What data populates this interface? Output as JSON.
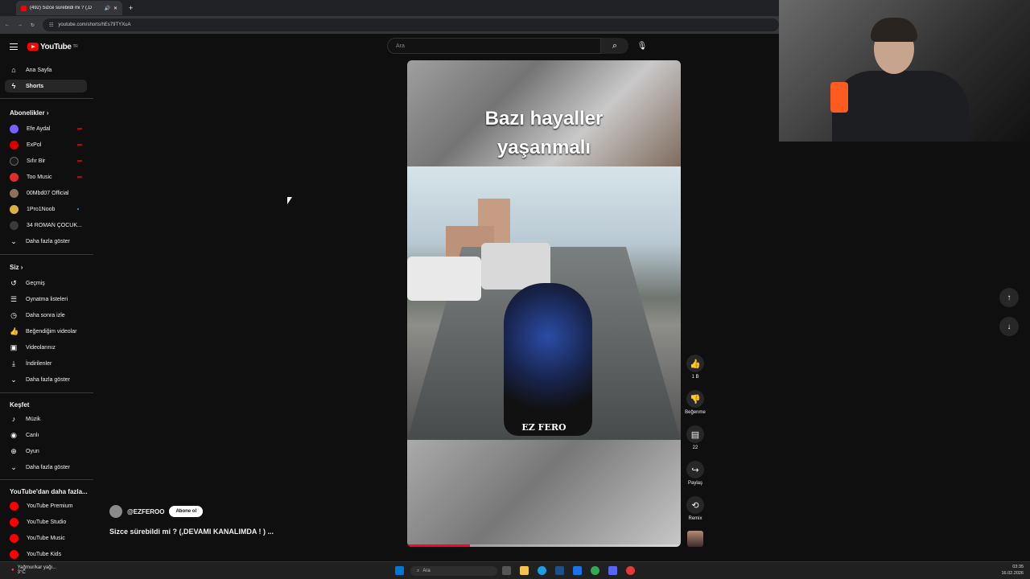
{
  "browser": {
    "tab_title": "(492) Sizce sürebildi mi ? (,D",
    "url": "youtube.com/shorts/hEs79TYXuA"
  },
  "header": {
    "logo": "YouTube",
    "country": "TR",
    "search_placeholder": "Ara"
  },
  "sidebar": {
    "main": [
      {
        "label": "Ana Sayfa",
        "icon": "home-icon"
      },
      {
        "label": "Shorts",
        "icon": "shorts-icon"
      }
    ],
    "subs_title": "Abonelikler",
    "subscriptions": [
      {
        "label": "Efe Aydal",
        "color": "#7a5cff",
        "live": true
      },
      {
        "label": "ExPol",
        "color": "#d60000",
        "live": true
      },
      {
        "label": "Sıfır Bir",
        "color": "#1a1a1a",
        "live": true
      },
      {
        "label": "Too Music",
        "color": "#e12c2c",
        "live": true
      },
      {
        "label": "00Mbd07 Official",
        "color": "#8b7359",
        "live": false
      },
      {
        "label": "1Pro1Noob",
        "color": "#d8b23f",
        "live": false,
        "new": true
      },
      {
        "label": "34 ROMAN ÇOCUK...",
        "color": "#3a3a3a",
        "live": false
      }
    ],
    "subs_more": "Daha fazla göster",
    "you_title": "Siz",
    "you": [
      {
        "label": "Geçmiş",
        "icon": "history-icon"
      },
      {
        "label": "Oynatma listeleri",
        "icon": "playlist-icon"
      },
      {
        "label": "Daha sonra izle",
        "icon": "watch-later-icon"
      },
      {
        "label": "Beğendiğim videolar",
        "icon": "like-icon"
      },
      {
        "label": "Videolarınız",
        "icon": "your-videos-icon"
      },
      {
        "label": "İndirilenler",
        "icon": "download-icon"
      },
      {
        "label": "Daha fazla göster",
        "icon": "chevron-down-icon"
      }
    ],
    "explore_title": "Keşfet",
    "explore": [
      {
        "label": "Müzik",
        "icon": "music-icon"
      },
      {
        "label": "Canlı",
        "icon": "live-icon"
      },
      {
        "label": "Oyun",
        "icon": "gaming-icon"
      },
      {
        "label": "Daha fazla göster",
        "icon": "chevron-down-icon"
      }
    ],
    "more_title": "YouTube'dan daha fazla...",
    "more": [
      {
        "label": "YouTube Premium"
      },
      {
        "label": "YouTube Studio"
      },
      {
        "label": "YouTube Music"
      },
      {
        "label": "YouTube Kids"
      }
    ]
  },
  "short": {
    "caption_line1": "Bazı hayaller",
    "caption_line2": "yaşanmalı",
    "watermark": "EZ FERO",
    "progress": 0.23,
    "channel": "@EZFEROO",
    "subscribe": "Abone ol",
    "title": "Sizce sürebildi mi ? (,DEVAMI KANALIMDA ! ) ..."
  },
  "actions": {
    "like_count": "1 B",
    "dislike": "Beğenme",
    "comment_count": "22",
    "share": "Paylaş",
    "remix": "Remix"
  },
  "taskbar": {
    "weather": "Yağmur/kar yağı...",
    "temp": "3°C",
    "search": "Ara",
    "time": "03:35",
    "date": "16.02.2026"
  }
}
